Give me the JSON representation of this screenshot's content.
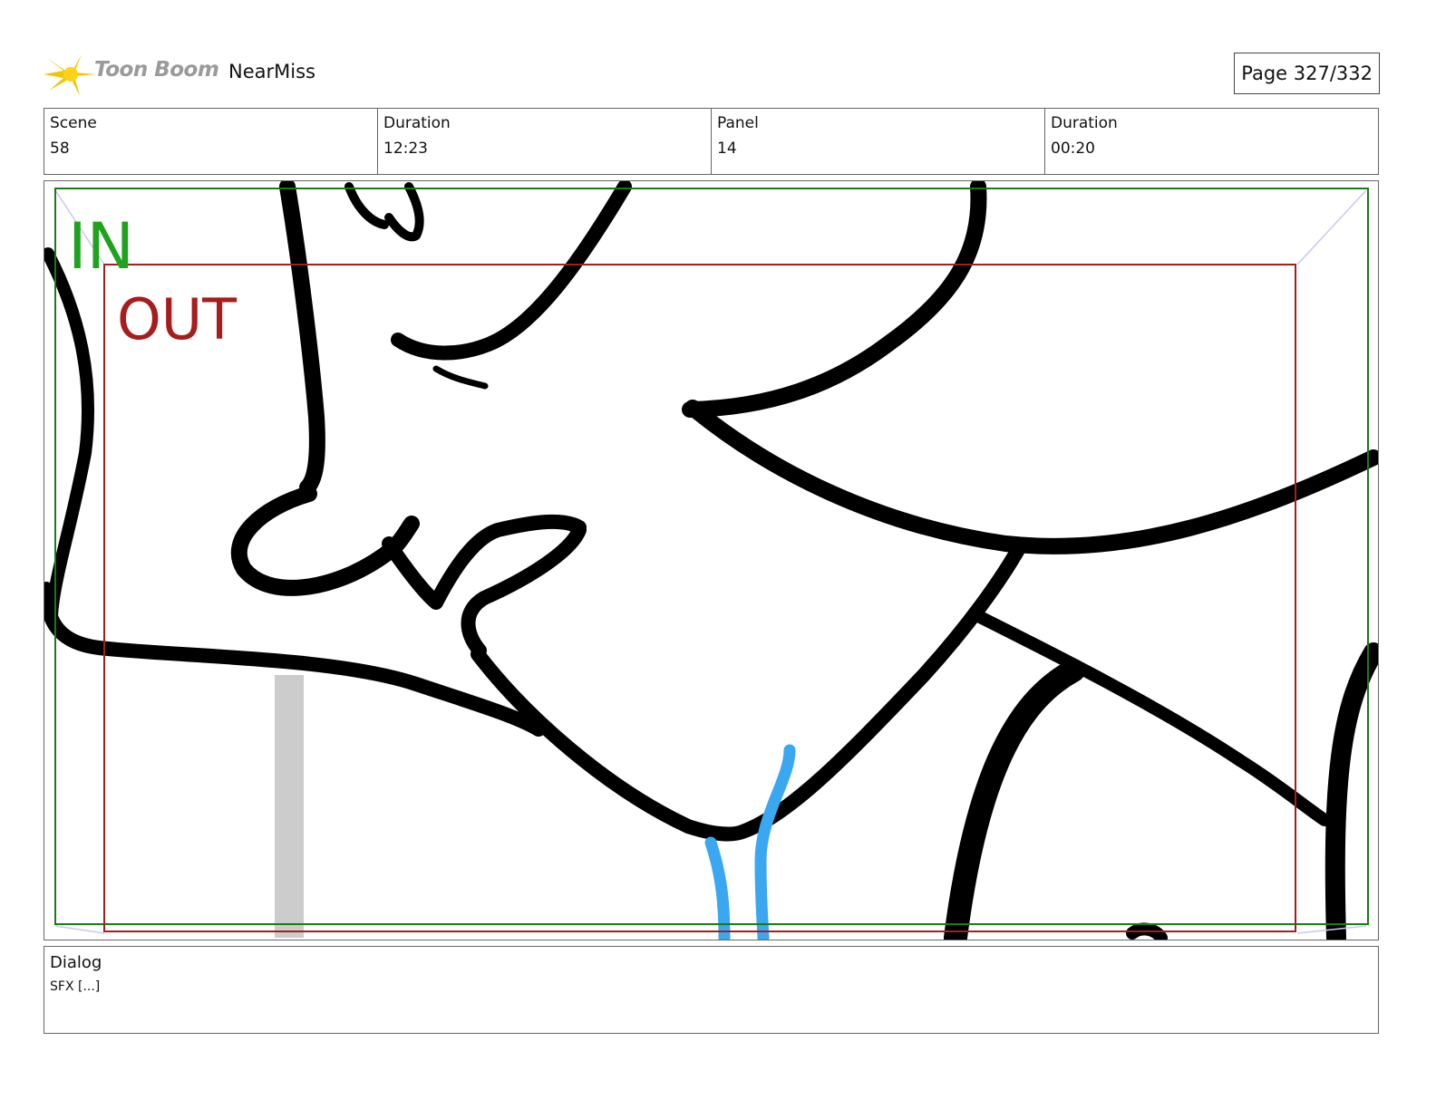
{
  "header": {
    "brand": "Toon Boom",
    "project": "NearMiss",
    "page": "Page 327/332"
  },
  "info": {
    "scene_label": "Scene",
    "scene_value": "58",
    "scene_duration_label": "Duration",
    "scene_duration_value": "12:23",
    "panel_label": "Panel",
    "panel_value": "14",
    "panel_duration_label": "Duration",
    "panel_duration_value": "00:20"
  },
  "panel": {
    "in_label": "IN",
    "out_label": "OUT",
    "colors": {
      "in_frame": "#1a7a1a",
      "in_text": "#1fa31f",
      "out_frame": "#a81c1c",
      "out_text": "#a81c1c",
      "ink": "#000000",
      "accent_blue": "#3aa8f0",
      "gray_bar": "#cccccc"
    }
  },
  "dialog": {
    "label": "Dialog",
    "text": "SFX [...]"
  }
}
